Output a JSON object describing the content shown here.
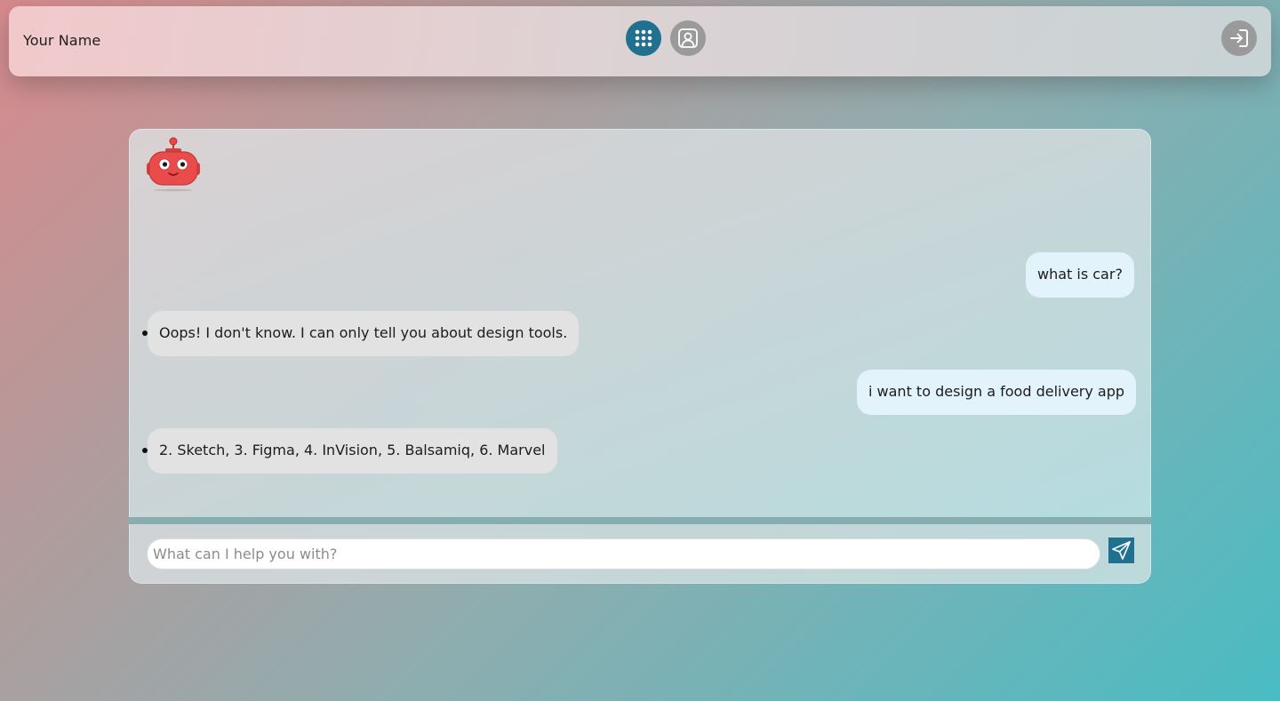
{
  "header": {
    "user_name": "Your Name",
    "icons": {
      "apps": "grid-dots-icon",
      "profile": "contact-card-icon",
      "logout": "sign-in-arrow-icon"
    }
  },
  "chat": {
    "bot_avatar": "robot-icon",
    "messages": [
      {
        "role": "user",
        "text": "what is car?"
      },
      {
        "role": "bot",
        "text": "Oops! I don't know. I can only tell you about design tools."
      },
      {
        "role": "user",
        "text": "i want to design a food delivery app"
      },
      {
        "role": "bot",
        "text": "2. Sketch, 3. Figma, 4. InVision, 5. Balsamiq, 6. Marvel"
      }
    ]
  },
  "composer": {
    "placeholder": "What can I help you with?",
    "value": "",
    "send_icon": "paper-plane-icon"
  },
  "colors": {
    "accent": "#20708f",
    "gray_button": "#9a9a9a",
    "user_bubble": "#e2f3fb",
    "bot_bubble": "#e2e2e2"
  }
}
